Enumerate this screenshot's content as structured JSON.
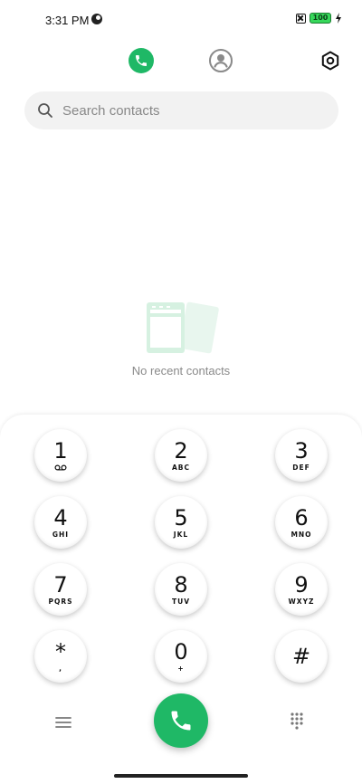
{
  "status_bar": {
    "time": "3:31 PM",
    "battery_level": "100",
    "battery_color": "#37d85b"
  },
  "tabs": {
    "active": "phone",
    "items": [
      {
        "name": "phone",
        "icon": "phone-icon"
      },
      {
        "name": "contacts",
        "icon": "person-icon"
      },
      {
        "name": "settings",
        "icon": "hexagon-settings-icon"
      }
    ],
    "accent_color": "#1fb866"
  },
  "search": {
    "placeholder": "Search contacts",
    "value": ""
  },
  "empty_state": {
    "message": "No recent contacts",
    "icon": "recent-contacts-illustration"
  },
  "dialpad": {
    "keys": [
      {
        "digit": "1",
        "letters": ""
      },
      {
        "digit": "2",
        "letters": "ABC"
      },
      {
        "digit": "3",
        "letters": "DEF"
      },
      {
        "digit": "4",
        "letters": "GHI"
      },
      {
        "digit": "5",
        "letters": "JKL"
      },
      {
        "digit": "6",
        "letters": "MNO"
      },
      {
        "digit": "7",
        "letters": "PQRS"
      },
      {
        "digit": "8",
        "letters": "TUV"
      },
      {
        "digit": "9",
        "letters": "WXYZ"
      },
      {
        "digit": "*",
        "letters": ","
      },
      {
        "digit": "0",
        "letters": "+"
      },
      {
        "digit": "#",
        "letters": ""
      }
    ]
  },
  "bottom_bar": {
    "menu_icon": "menu-icon",
    "call_icon": "phone-icon",
    "keypad_icon": "dialpad-icon"
  }
}
